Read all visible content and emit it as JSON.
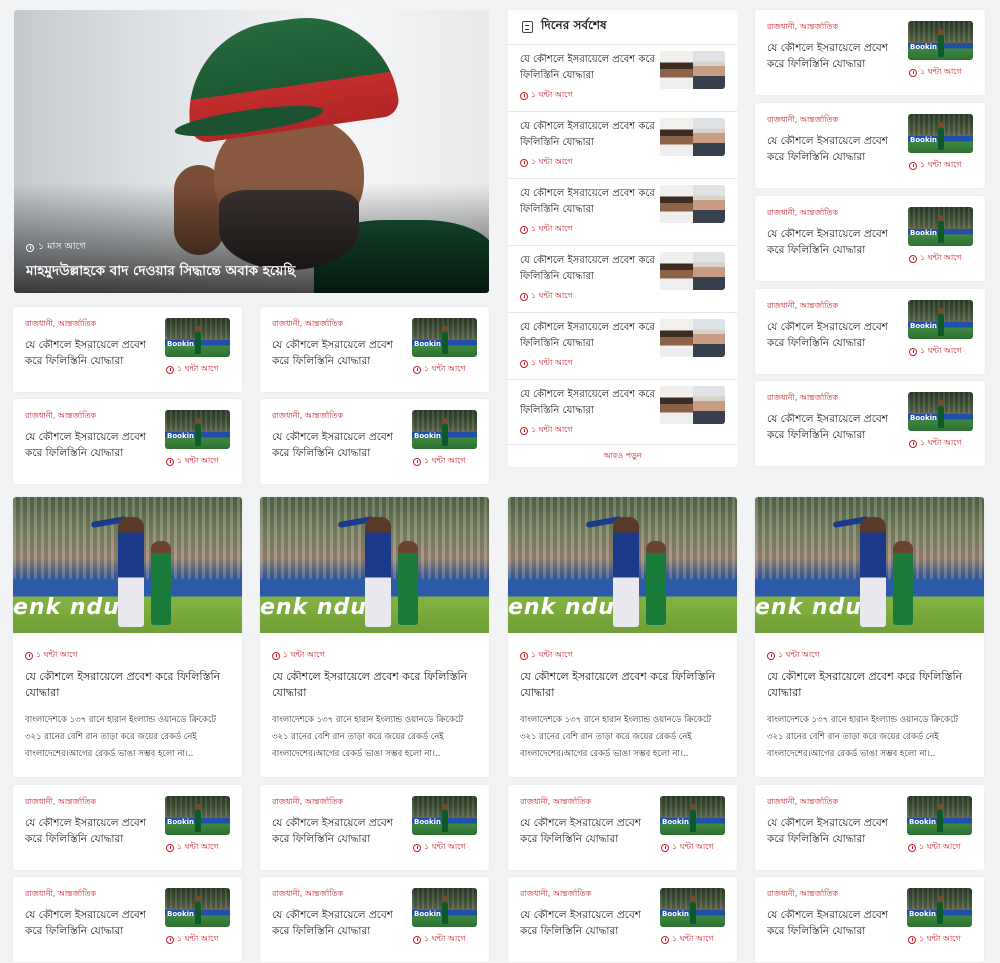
{
  "hero": {
    "time": "১ মাস আগে",
    "title": "মাহমুদউল্লাহকে বাদ দেওয়ার সিদ্ধান্তে অবাক হয়েছি"
  },
  "latest": {
    "heading": "দিনের সর্বশেষ",
    "items": [
      {
        "title": "যে কৌশলে ইসরায়েলে প্রবেশ করে ফিলিস্তিনি যোদ্ধারা",
        "time": "১ ঘন্টা আগে"
      },
      {
        "title": "যে কৌশলে ইসরায়েলে প্রবেশ করে ফিলিস্তিনি যোদ্ধারা",
        "time": "১ ঘন্টা আগে"
      },
      {
        "title": "যে কৌশলে ইসরায়েলে প্রবেশ করে ফিলিস্তিনি যোদ্ধারা",
        "time": "১ ঘন্টা আগে"
      },
      {
        "title": "যে কৌশলে ইসরায়েলে প্রবেশ করে ফিলিস্তিনি যোদ্ধারা",
        "time": "১ ঘন্টা আগে"
      },
      {
        "title": "যে কৌশলে ইসরায়েলে প্রবেশ করে ফিলিস্তিনি যোদ্ধারা",
        "time": "১ ঘন্টা আগে"
      },
      {
        "title": "যে কৌশলে ইসরায়েলে প্রবেশ করে ফিলিস্তিনি যোদ্ধারা",
        "time": "১ ঘন্টা আগে"
      }
    ],
    "more": "আরও পড়ুন"
  },
  "small": {
    "cat1": "রাজধানী,",
    "cat2": "আন্তর্জাতিক",
    "title": "যে কৌশলে ইসরায়েলে প্রবেশ করে ফিলিস্তিনি যোদ্ধারা",
    "time": "১ ঘন্টা আগে",
    "thumb_text": "Bookin"
  },
  "big": {
    "time": "১ ঘন্টা আগে",
    "title": "যে কৌশলে ইসরায়েলে প্রবেশ করে ফিলিস্তিনি যোদ্ধারা",
    "excerpt": "বাংলাদেশকে ১৩৭ রানে হারান ইংল্যান্ড ওয়ানডে ক্রিকেটে ৩২১ রানের বেশি রান তাড়া করে জয়ের রেকর্ড নেই বাংলাদেশের।আগের রেকর্ড ভাঙা সম্ভব হলো না।..",
    "ad_text": "enk  ndus"
  }
}
